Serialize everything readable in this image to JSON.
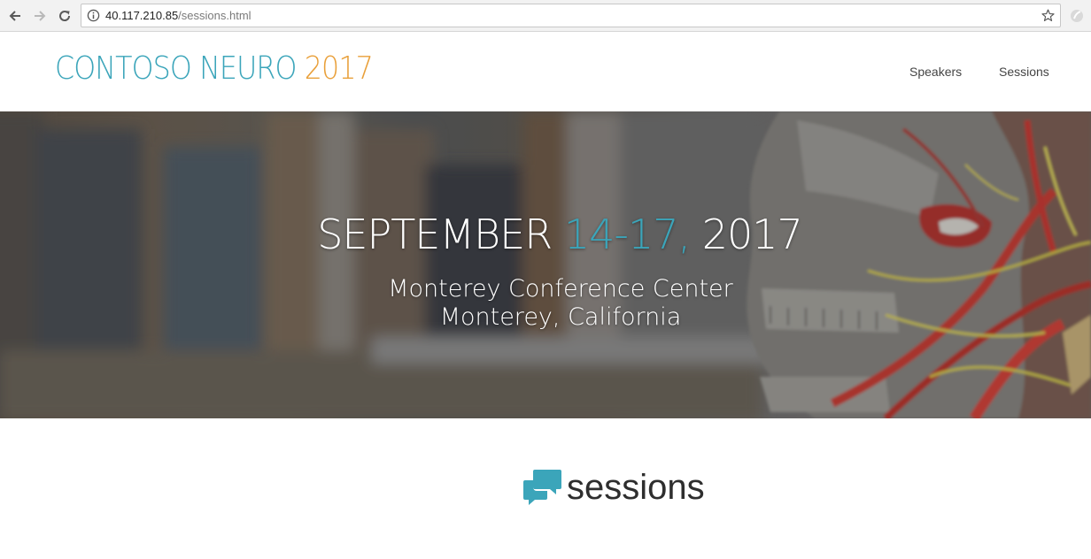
{
  "browser": {
    "url_host": "40.117.210.85",
    "url_path": "/sessions.html"
  },
  "header": {
    "logo_name": "CONTOSO NEURO ",
    "logo_year": "2017",
    "nav": [
      {
        "label": "Speakers"
      },
      {
        "label": "Sessions"
      }
    ]
  },
  "hero": {
    "month": "SEPTEMBER ",
    "days": "14-17,",
    "year": " 2017",
    "venue_line1": "Monterey Conference Center",
    "venue_line2": "Monterey, California"
  },
  "main": {
    "section_title": "sessions",
    "section_icon": "chat-bubbles-icon"
  },
  "colors": {
    "accent_teal": "#3ba5ba",
    "accent_orange": "#e9a03a",
    "text_dark": "#2e2e2e"
  }
}
